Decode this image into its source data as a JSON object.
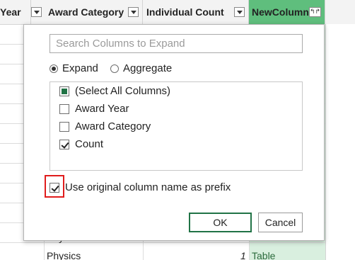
{
  "grid": {
    "headers": {
      "col1_label": "Year",
      "col2_label": "Award Category",
      "col3_label": "Individual Count",
      "col4_label": "NewColumn",
      "expand_icon": "↰↱"
    },
    "rows": {
      "row1_category": "Physics",
      "row1_count": "1",
      "row1_value": "Table",
      "row2_category": "Physics",
      "row2_count": "1",
      "row2_value": "Table"
    },
    "colors": {
      "new_column_header": "#5fbe7d",
      "new_column_cells": "#d9efdf"
    }
  },
  "expand_popup": {
    "search": {
      "placeholder": "Search Columns to Expand",
      "value": ""
    },
    "mode": {
      "expand_label": "Expand",
      "aggregate_label": "Aggregate",
      "selected": "Expand"
    },
    "columns": [
      {
        "label": "(Select All Columns)",
        "state": "partial"
      },
      {
        "label": "Award Year",
        "state": "unchecked"
      },
      {
        "label": "Award Category",
        "state": "unchecked"
      },
      {
        "label": "Count",
        "state": "checked"
      }
    ],
    "prefix_option": {
      "label": "Use original column name as prefix",
      "checked": true
    },
    "buttons": {
      "ok_label": "OK",
      "cancel_label": "Cancel"
    },
    "colors": {
      "accent": "#217346",
      "highlight": "#e01c1c"
    }
  }
}
